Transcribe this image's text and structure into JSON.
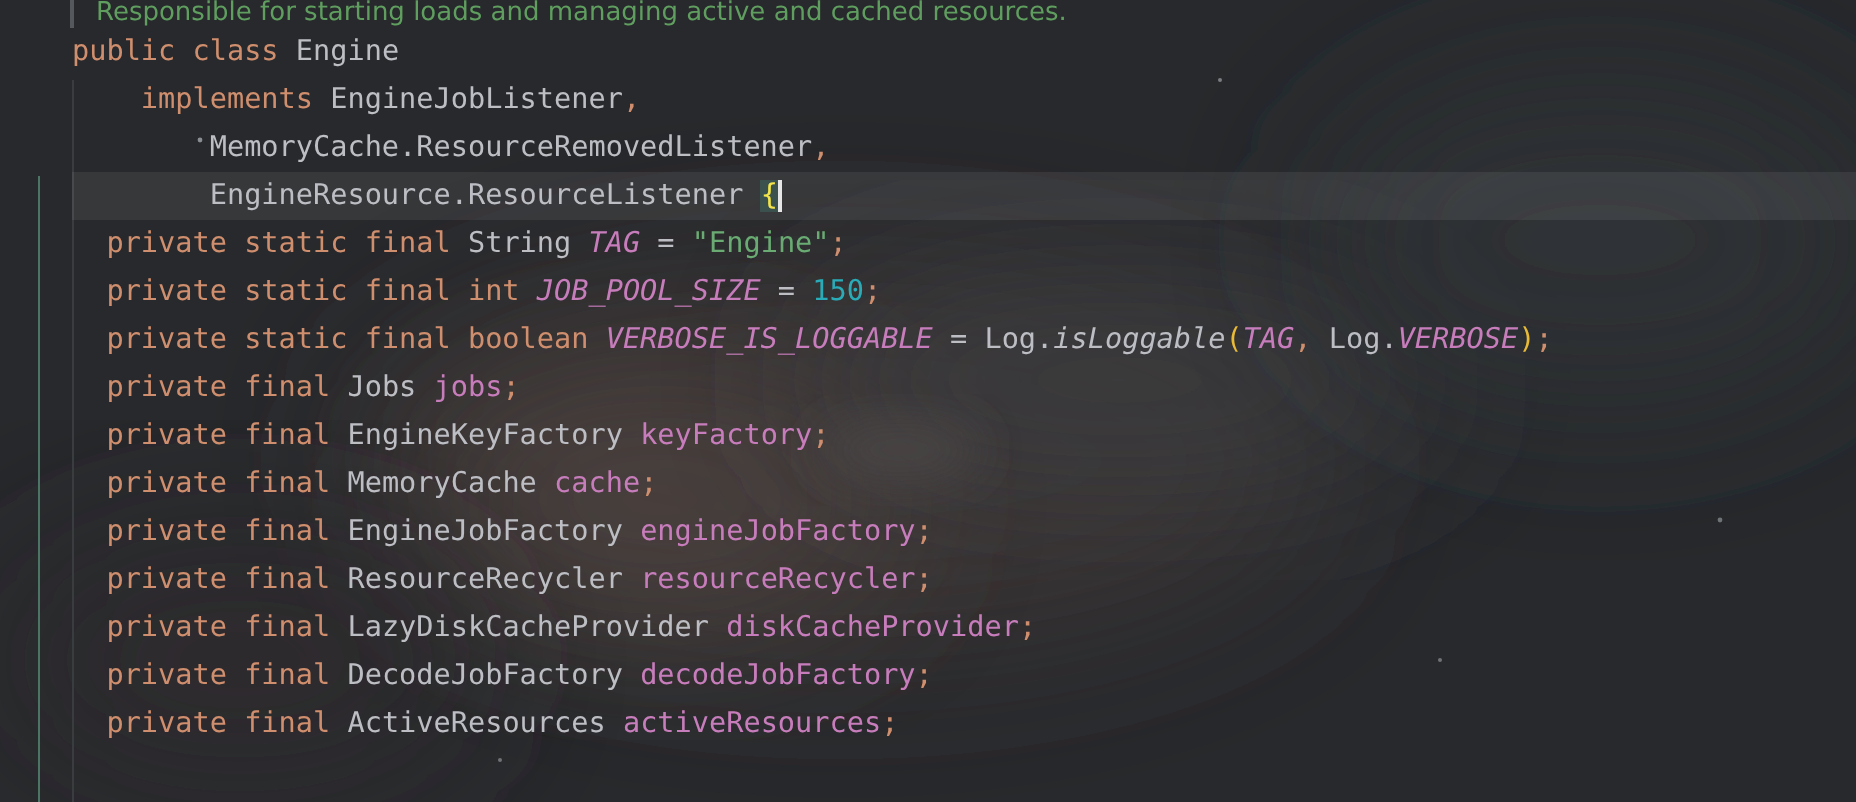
{
  "editor": {
    "lines": [
      {
        "current": false,
        "tokens": [
          {
            "kind": "comment",
            "t": "Responsible for starting loads and managing active and cached resources."
          }
        ]
      },
      {
        "current": false,
        "tokens": [
          {
            "kind": "keyword",
            "t": "public class "
          },
          {
            "kind": "plain",
            "t": "Engine"
          }
        ]
      },
      {
        "current": false,
        "tokens": [
          {
            "kind": "keyword",
            "t": "    implements "
          },
          {
            "kind": "plain",
            "t": "EngineJobListener"
          },
          {
            "kind": "keyword",
            "t": ","
          }
        ]
      },
      {
        "current": false,
        "tokens": [
          {
            "kind": "plain",
            "t": "        MemoryCache.ResourceRemovedListener"
          },
          {
            "kind": "keyword",
            "t": ","
          }
        ]
      },
      {
        "current": true,
        "tokens": [
          {
            "kind": "plain",
            "t": "        EngineResource.ResourceListener "
          },
          {
            "kind": "bracket",
            "t": "{"
          }
        ]
      },
      {
        "current": false,
        "tokens": [
          {
            "kind": "keyword",
            "t": "  private static final "
          },
          {
            "kind": "plain",
            "t": "String "
          },
          {
            "kind": "constant",
            "t": "TAG"
          },
          {
            "kind": "plain",
            "t": " = "
          },
          {
            "kind": "string",
            "t": "\"Engine\""
          },
          {
            "kind": "keyword",
            "t": ";"
          }
        ]
      },
      {
        "current": false,
        "tokens": [
          {
            "kind": "keyword",
            "t": "  private static final int "
          },
          {
            "kind": "constant",
            "t": "JOB_POOL_SIZE"
          },
          {
            "kind": "plain",
            "t": " = "
          },
          {
            "kind": "number",
            "t": "150"
          },
          {
            "kind": "keyword",
            "t": ";"
          }
        ]
      },
      {
        "current": false,
        "tokens": [
          {
            "kind": "keyword",
            "t": "  private static final boolean "
          },
          {
            "kind": "constant",
            "t": "VERBOSE_IS_LOGGABLE"
          },
          {
            "kind": "plain",
            "t": " = Log."
          },
          {
            "kind": "method",
            "t": "isLoggable"
          },
          {
            "kind": "paren",
            "t": "("
          },
          {
            "kind": "constant",
            "t": "TAG"
          },
          {
            "kind": "keyword",
            "t": ", "
          },
          {
            "kind": "plain",
            "t": "Log."
          },
          {
            "kind": "constant",
            "t": "VERBOSE"
          },
          {
            "kind": "paren",
            "t": ")"
          },
          {
            "kind": "keyword",
            "t": ";"
          }
        ]
      },
      {
        "current": false,
        "tokens": [
          {
            "kind": "keyword",
            "t": "  private final "
          },
          {
            "kind": "plain",
            "t": "Jobs "
          },
          {
            "kind": "field",
            "t": "jobs"
          },
          {
            "kind": "keyword",
            "t": ";"
          }
        ]
      },
      {
        "current": false,
        "tokens": [
          {
            "kind": "keyword",
            "t": "  private final "
          },
          {
            "kind": "plain",
            "t": "EngineKeyFactory "
          },
          {
            "kind": "field",
            "t": "keyFactory"
          },
          {
            "kind": "keyword",
            "t": ";"
          }
        ]
      },
      {
        "current": false,
        "tokens": [
          {
            "kind": "keyword",
            "t": "  private final "
          },
          {
            "kind": "plain",
            "t": "MemoryCache "
          },
          {
            "kind": "field",
            "t": "cache"
          },
          {
            "kind": "keyword",
            "t": ";"
          }
        ]
      },
      {
        "current": false,
        "tokens": [
          {
            "kind": "keyword",
            "t": "  private final "
          },
          {
            "kind": "plain",
            "t": "EngineJobFactory "
          },
          {
            "kind": "field",
            "t": "engineJobFactory"
          },
          {
            "kind": "keyword",
            "t": ";"
          }
        ]
      },
      {
        "current": false,
        "tokens": [
          {
            "kind": "keyword",
            "t": "  private final "
          },
          {
            "kind": "plain",
            "t": "ResourceRecycler "
          },
          {
            "kind": "field",
            "t": "resourceRecycler"
          },
          {
            "kind": "keyword",
            "t": ";"
          }
        ]
      },
      {
        "current": false,
        "tokens": [
          {
            "kind": "keyword",
            "t": "  private final "
          },
          {
            "kind": "plain",
            "t": "LazyDiskCacheProvider "
          },
          {
            "kind": "field",
            "t": "diskCacheProvider"
          },
          {
            "kind": "keyword",
            "t": ";"
          }
        ]
      },
      {
        "current": false,
        "tokens": [
          {
            "kind": "keyword",
            "t": "  private final "
          },
          {
            "kind": "plain",
            "t": "DecodeJobFactory "
          },
          {
            "kind": "field",
            "t": "decodeJobFactory"
          },
          {
            "kind": "keyword",
            "t": ";"
          }
        ]
      },
      {
        "current": false,
        "tokens": [
          {
            "kind": "keyword",
            "t": "  private final "
          },
          {
            "kind": "plain",
            "t": "ActiveResources "
          },
          {
            "kind": "field",
            "t": "activeResources"
          },
          {
            "kind": "keyword",
            "t": ";"
          }
        ]
      }
    ]
  }
}
